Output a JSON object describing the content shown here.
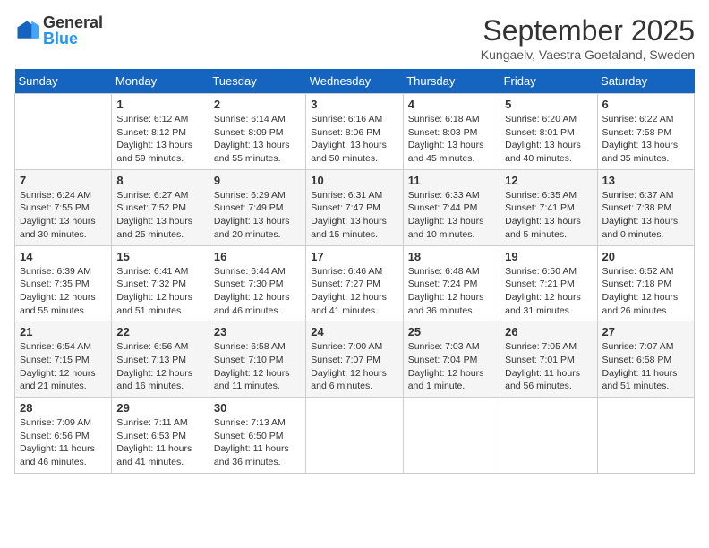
{
  "header": {
    "logo": {
      "general": "General",
      "blue": "Blue"
    },
    "title": "September 2025",
    "location": "Kungaelv, Vaestra Goetaland, Sweden"
  },
  "calendar": {
    "days_of_week": [
      "Sunday",
      "Monday",
      "Tuesday",
      "Wednesday",
      "Thursday",
      "Friday",
      "Saturday"
    ],
    "weeks": [
      {
        "cells": [
          {
            "day": "",
            "info": ""
          },
          {
            "day": "1",
            "info": "Sunrise: 6:12 AM\nSunset: 8:12 PM\nDaylight: 13 hours\nand 59 minutes."
          },
          {
            "day": "2",
            "info": "Sunrise: 6:14 AM\nSunset: 8:09 PM\nDaylight: 13 hours\nand 55 minutes."
          },
          {
            "day": "3",
            "info": "Sunrise: 6:16 AM\nSunset: 8:06 PM\nDaylight: 13 hours\nand 50 minutes."
          },
          {
            "day": "4",
            "info": "Sunrise: 6:18 AM\nSunset: 8:03 PM\nDaylight: 13 hours\nand 45 minutes."
          },
          {
            "day": "5",
            "info": "Sunrise: 6:20 AM\nSunset: 8:01 PM\nDaylight: 13 hours\nand 40 minutes."
          },
          {
            "day": "6",
            "info": "Sunrise: 6:22 AM\nSunset: 7:58 PM\nDaylight: 13 hours\nand 35 minutes."
          }
        ]
      },
      {
        "cells": [
          {
            "day": "7",
            "info": "Sunrise: 6:24 AM\nSunset: 7:55 PM\nDaylight: 13 hours\nand 30 minutes."
          },
          {
            "day": "8",
            "info": "Sunrise: 6:27 AM\nSunset: 7:52 PM\nDaylight: 13 hours\nand 25 minutes."
          },
          {
            "day": "9",
            "info": "Sunrise: 6:29 AM\nSunset: 7:49 PM\nDaylight: 13 hours\nand 20 minutes."
          },
          {
            "day": "10",
            "info": "Sunrise: 6:31 AM\nSunset: 7:47 PM\nDaylight: 13 hours\nand 15 minutes."
          },
          {
            "day": "11",
            "info": "Sunrise: 6:33 AM\nSunset: 7:44 PM\nDaylight: 13 hours\nand 10 minutes."
          },
          {
            "day": "12",
            "info": "Sunrise: 6:35 AM\nSunset: 7:41 PM\nDaylight: 13 hours\nand 5 minutes."
          },
          {
            "day": "13",
            "info": "Sunrise: 6:37 AM\nSunset: 7:38 PM\nDaylight: 13 hours\nand 0 minutes."
          }
        ]
      },
      {
        "cells": [
          {
            "day": "14",
            "info": "Sunrise: 6:39 AM\nSunset: 7:35 PM\nDaylight: 12 hours\nand 55 minutes."
          },
          {
            "day": "15",
            "info": "Sunrise: 6:41 AM\nSunset: 7:32 PM\nDaylight: 12 hours\nand 51 minutes."
          },
          {
            "day": "16",
            "info": "Sunrise: 6:44 AM\nSunset: 7:30 PM\nDaylight: 12 hours\nand 46 minutes."
          },
          {
            "day": "17",
            "info": "Sunrise: 6:46 AM\nSunset: 7:27 PM\nDaylight: 12 hours\nand 41 minutes."
          },
          {
            "day": "18",
            "info": "Sunrise: 6:48 AM\nSunset: 7:24 PM\nDaylight: 12 hours\nand 36 minutes."
          },
          {
            "day": "19",
            "info": "Sunrise: 6:50 AM\nSunset: 7:21 PM\nDaylight: 12 hours\nand 31 minutes."
          },
          {
            "day": "20",
            "info": "Sunrise: 6:52 AM\nSunset: 7:18 PM\nDaylight: 12 hours\nand 26 minutes."
          }
        ]
      },
      {
        "cells": [
          {
            "day": "21",
            "info": "Sunrise: 6:54 AM\nSunset: 7:15 PM\nDaylight: 12 hours\nand 21 minutes."
          },
          {
            "day": "22",
            "info": "Sunrise: 6:56 AM\nSunset: 7:13 PM\nDaylight: 12 hours\nand 16 minutes."
          },
          {
            "day": "23",
            "info": "Sunrise: 6:58 AM\nSunset: 7:10 PM\nDaylight: 12 hours\nand 11 minutes."
          },
          {
            "day": "24",
            "info": "Sunrise: 7:00 AM\nSunset: 7:07 PM\nDaylight: 12 hours\nand 6 minutes."
          },
          {
            "day": "25",
            "info": "Sunrise: 7:03 AM\nSunset: 7:04 PM\nDaylight: 12 hours\nand 1 minute."
          },
          {
            "day": "26",
            "info": "Sunrise: 7:05 AM\nSunset: 7:01 PM\nDaylight: 11 hours\nand 56 minutes."
          },
          {
            "day": "27",
            "info": "Sunrise: 7:07 AM\nSunset: 6:58 PM\nDaylight: 11 hours\nand 51 minutes."
          }
        ]
      },
      {
        "cells": [
          {
            "day": "28",
            "info": "Sunrise: 7:09 AM\nSunset: 6:56 PM\nDaylight: 11 hours\nand 46 minutes."
          },
          {
            "day": "29",
            "info": "Sunrise: 7:11 AM\nSunset: 6:53 PM\nDaylight: 11 hours\nand 41 minutes."
          },
          {
            "day": "30",
            "info": "Sunrise: 7:13 AM\nSunset: 6:50 PM\nDaylight: 11 hours\nand 36 minutes."
          },
          {
            "day": "",
            "info": ""
          },
          {
            "day": "",
            "info": ""
          },
          {
            "day": "",
            "info": ""
          },
          {
            "day": "",
            "info": ""
          }
        ]
      }
    ]
  }
}
